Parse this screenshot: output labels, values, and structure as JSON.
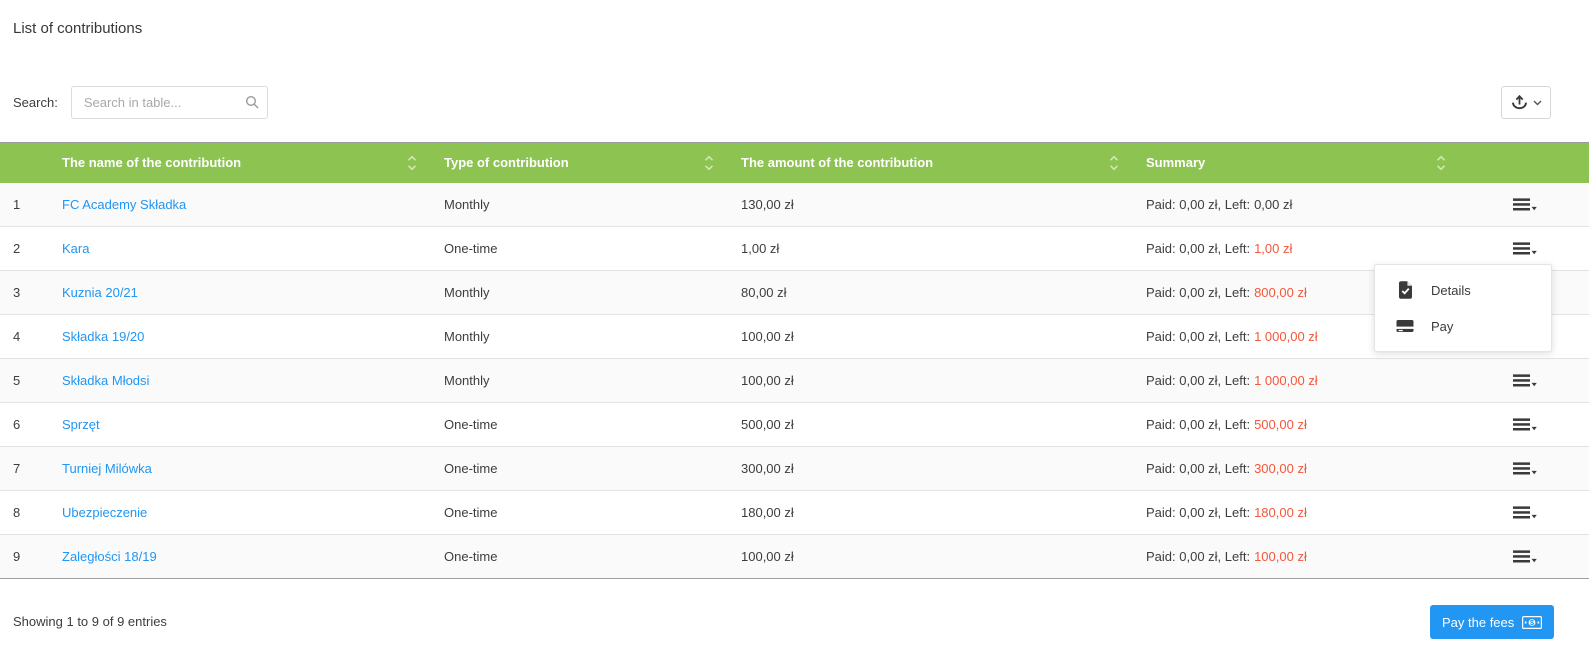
{
  "page": {
    "title": "List of contributions"
  },
  "search": {
    "label": "Search:",
    "placeholder": "Search in table..."
  },
  "icons": {
    "search": "magnifier",
    "export": "upload-tray",
    "export_chevron": "chevron-down",
    "sort": "up-down-carets",
    "row_actions": "hamburger-caret",
    "details": "file-check",
    "pay": "credit-card",
    "pay_fees": "banknote-dollar"
  },
  "table": {
    "columns": [
      {
        "label": "The name of the contribution"
      },
      {
        "label": "Type of contribution"
      },
      {
        "label": "The amount of the contribution"
      },
      {
        "label": "Summary"
      }
    ],
    "rows": [
      {
        "num": "1",
        "name": "FC Academy Składka",
        "type": "Monthly",
        "amount": "130,00 zł",
        "summary_prefix": "Paid: 0,00 zł, Left:",
        "summary_left": "0,00 zł",
        "left_red": false
      },
      {
        "num": "2",
        "name": "Kara",
        "type": "One-time",
        "amount": "1,00 zł",
        "summary_prefix": "Paid: 0,00 zł, Left:",
        "summary_left": "1,00 zł",
        "left_red": true
      },
      {
        "num": "3",
        "name": "Kuznia 20/21",
        "type": "Monthly",
        "amount": "80,00 zł",
        "summary_prefix": "Paid: 0,00 zł, Left:",
        "summary_left": "800,00 zł",
        "left_red": true
      },
      {
        "num": "4",
        "name": "Składka 19/20",
        "type": "Monthly",
        "amount": "100,00 zł",
        "summary_prefix": "Paid: 0,00 zł, Left:",
        "summary_left": "1 000,00 zł",
        "left_red": true
      },
      {
        "num": "5",
        "name": "Składka Młodsi",
        "type": "Monthly",
        "amount": "100,00 zł",
        "summary_prefix": "Paid: 0,00 zł, Left:",
        "summary_left": "1 000,00 zł",
        "left_red": true
      },
      {
        "num": "6",
        "name": "Sprzęt",
        "type": "One-time",
        "amount": "500,00 zł",
        "summary_prefix": "Paid: 0,00 zł, Left:",
        "summary_left": "500,00 zł",
        "left_red": true
      },
      {
        "num": "7",
        "name": "Turniej Milówka",
        "type": "One-time",
        "amount": "300,00 zł",
        "summary_prefix": "Paid: 0,00 zł, Left:",
        "summary_left": "300,00 zł",
        "left_red": true
      },
      {
        "num": "8",
        "name": "Ubezpieczenie",
        "type": "One-time",
        "amount": "180,00 zł",
        "summary_prefix": "Paid: 0,00 zł, Left:",
        "summary_left": "180,00 zł",
        "left_red": true
      },
      {
        "num": "9",
        "name": "Zaległości 18/19",
        "type": "One-time",
        "amount": "100,00 zł",
        "summary_prefix": "Paid: 0,00 zł, Left:",
        "summary_left": "100,00 zł",
        "left_red": true
      }
    ]
  },
  "row_menu": {
    "items": [
      {
        "label": "Details",
        "icon": "file-check-icon"
      },
      {
        "label": "Pay",
        "icon": "credit-card-icon"
      }
    ]
  },
  "footer": {
    "showing_text": "Showing 1 to 9 of 9 entries",
    "pay_button_label": "Pay the fees"
  },
  "colors": {
    "header_green": "#8dc351",
    "link_blue": "#2196f3",
    "left_red": "#f4573c",
    "button_blue": "#2196f3"
  }
}
